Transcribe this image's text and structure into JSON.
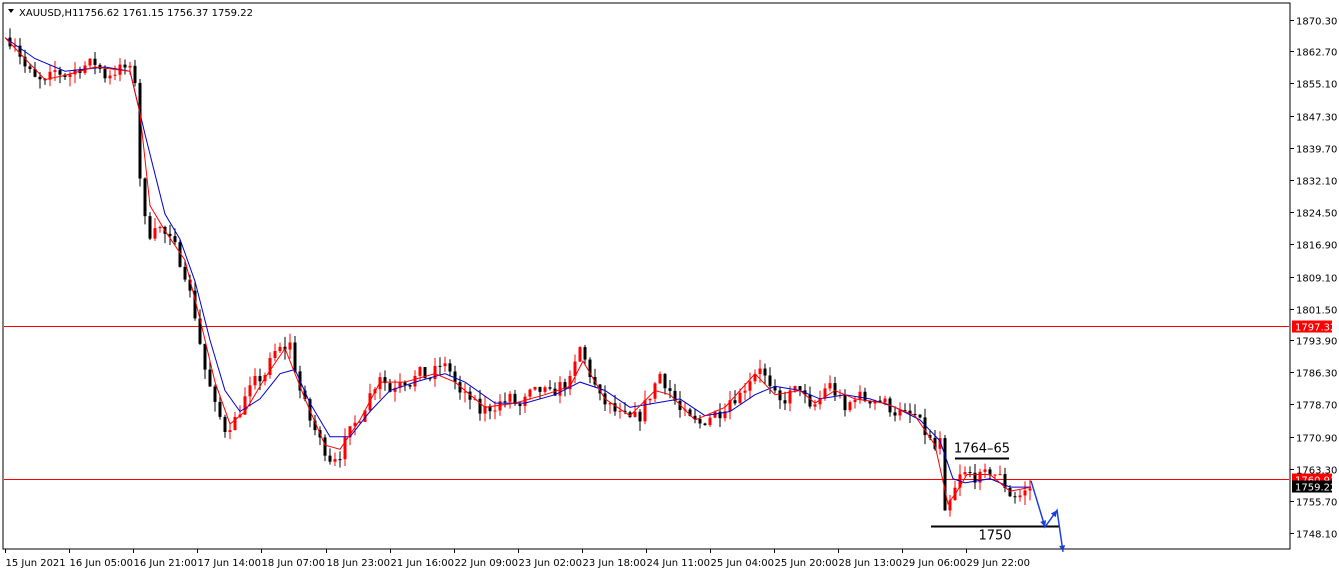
{
  "header": {
    "symbol": "XAUUSD,H1",
    "ohlc": "1756.62 1761.15 1756.37 1759.22"
  },
  "colors": {
    "bull": "#ff0000",
    "bear": "#000000",
    "ma_fast": "#ff0000",
    "ma_slow": "#0000cc",
    "hline": "#ff0000",
    "arrow": "#1a3fe0",
    "price_box_bg": "#ff0000",
    "current_box_bg": "#000000",
    "frame": "#000000"
  },
  "chart_data": {
    "type": "candlestick",
    "title": "",
    "xlabel": "",
    "ylabel": "",
    "ylim": [
      1744.5,
      1874.0
    ],
    "y_ticks": [
      "1870.30",
      "1862.70",
      "1855.10",
      "1847.30",
      "1839.70",
      "1832.10",
      "1824.50",
      "1816.90",
      "1809.10",
      "1801.50",
      "1793.90",
      "1786.30",
      "1778.70",
      "1770.90",
      "1763.30",
      "1755.70",
      "1748.10"
    ],
    "x_ticks": [
      "15 Jun 2021",
      "16 Jun 05:00",
      "16 Jun 21:00",
      "17 Jun 14:00",
      "18 Jun 07:00",
      "18 Jun 23:00",
      "21 Jun 16:00",
      "22 Jun 09:00",
      "23 Jun 02:00",
      "23 Jun 18:00",
      "24 Jun 11:00",
      "25 Jun 04:00",
      "25 Jun 20:00",
      "28 Jun 13:00",
      "29 Jun 06:00",
      "29 Jun 22:00"
    ],
    "price_path": [
      [
        0,
        1866
      ],
      [
        10,
        1865
      ],
      [
        20,
        1859
      ],
      [
        30,
        1856
      ],
      [
        40,
        1855
      ],
      [
        50,
        1858
      ],
      [
        62,
        1857
      ],
      [
        75,
        1859
      ],
      [
        90,
        1860
      ],
      [
        100,
        1857
      ],
      [
        110,
        1858
      ],
      [
        122,
        1859
      ],
      [
        130,
        1856
      ],
      [
        135,
        1833
      ],
      [
        142,
        1818
      ],
      [
        150,
        1822
      ],
      [
        160,
        1819
      ],
      [
        170,
        1816
      ],
      [
        180,
        1810
      ],
      [
        190,
        1800
      ],
      [
        200,
        1787
      ],
      [
        210,
        1778
      ],
      [
        220,
        1773
      ],
      [
        230,
        1775
      ],
      [
        240,
        1780
      ],
      [
        250,
        1784
      ],
      [
        260,
        1786
      ],
      [
        270,
        1791
      ],
      [
        285,
        1793
      ],
      [
        295,
        1782
      ],
      [
        305,
        1775
      ],
      [
        315,
        1770
      ],
      [
        325,
        1766
      ],
      [
        335,
        1767
      ],
      [
        345,
        1772
      ],
      [
        355,
        1776
      ],
      [
        365,
        1781
      ],
      [
        375,
        1786
      ],
      [
        385,
        1782
      ],
      [
        395,
        1785
      ],
      [
        405,
        1784
      ],
      [
        415,
        1786
      ],
      [
        425,
        1785
      ],
      [
        435,
        1788
      ],
      [
        445,
        1787
      ],
      [
        455,
        1781
      ],
      [
        465,
        1780
      ],
      [
        475,
        1777
      ],
      [
        485,
        1778
      ],
      [
        495,
        1779
      ],
      [
        505,
        1780
      ],
      [
        515,
        1778
      ],
      [
        525,
        1781
      ],
      [
        535,
        1782
      ],
      [
        545,
        1781
      ],
      [
        555,
        1783
      ],
      [
        565,
        1784
      ],
      [
        575,
        1792
      ],
      [
        585,
        1786
      ],
      [
        595,
        1780
      ],
      [
        605,
        1778
      ],
      [
        615,
        1776
      ],
      [
        625,
        1775
      ],
      [
        635,
        1776
      ],
      [
        645,
        1781
      ],
      [
        655,
        1786
      ],
      [
        665,
        1782
      ],
      [
        675,
        1777
      ],
      [
        685,
        1775
      ],
      [
        695,
        1774
      ],
      [
        705,
        1776
      ],
      [
        715,
        1777
      ],
      [
        725,
        1780
      ],
      [
        735,
        1781
      ],
      [
        745,
        1785
      ],
      [
        755,
        1788
      ],
      [
        765,
        1782
      ],
      [
        775,
        1779
      ],
      [
        785,
        1781
      ],
      [
        795,
        1783
      ],
      [
        805,
        1777
      ],
      [
        815,
        1780
      ],
      [
        822,
        1784
      ],
      [
        832,
        1781
      ],
      [
        840,
        1777
      ],
      [
        850,
        1781
      ],
      [
        860,
        1780
      ],
      [
        870,
        1780
      ],
      [
        880,
        1779
      ],
      [
        890,
        1777
      ],
      [
        900,
        1776
      ],
      [
        910,
        1776
      ],
      [
        920,
        1772
      ],
      [
        930,
        1768
      ],
      [
        936,
        1770
      ],
      [
        940,
        1752
      ],
      [
        948,
        1757
      ],
      [
        956,
        1762
      ],
      [
        966,
        1762
      ],
      [
        976,
        1761
      ],
      [
        986,
        1763
      ],
      [
        996,
        1761
      ],
      [
        1006,
        1757
      ],
      [
        1016,
        1757
      ],
      [
        1026,
        1759
      ]
    ],
    "ma_fast": [
      [
        0,
        1866
      ],
      [
        20,
        1861
      ],
      [
        40,
        1856
      ],
      [
        60,
        1857
      ],
      [
        90,
        1859
      ],
      [
        125,
        1858
      ],
      [
        135,
        1848
      ],
      [
        145,
        1826
      ],
      [
        160,
        1820
      ],
      [
        180,
        1813
      ],
      [
        195,
        1799
      ],
      [
        210,
        1784
      ],
      [
        225,
        1774
      ],
      [
        240,
        1777
      ],
      [
        260,
        1785
      ],
      [
        280,
        1792
      ],
      [
        300,
        1780
      ],
      [
        320,
        1769
      ],
      [
        335,
        1768
      ],
      [
        355,
        1775
      ],
      [
        375,
        1784
      ],
      [
        400,
        1784
      ],
      [
        430,
        1786
      ],
      [
        450,
        1784
      ],
      [
        480,
        1778
      ],
      [
        510,
        1779
      ],
      [
        540,
        1781
      ],
      [
        565,
        1783
      ],
      [
        578,
        1789
      ],
      [
        600,
        1780
      ],
      [
        625,
        1776
      ],
      [
        650,
        1782
      ],
      [
        665,
        1781
      ],
      [
        690,
        1775
      ],
      [
        720,
        1778
      ],
      [
        750,
        1786
      ],
      [
        770,
        1781
      ],
      [
        795,
        1782
      ],
      [
        810,
        1779
      ],
      [
        830,
        1782
      ],
      [
        850,
        1780
      ],
      [
        880,
        1779
      ],
      [
        910,
        1776
      ],
      [
        930,
        1769
      ],
      [
        943,
        1755
      ],
      [
        952,
        1758
      ],
      [
        962,
        1762
      ],
      [
        985,
        1762
      ],
      [
        1005,
        1758
      ],
      [
        1026,
        1759
      ]
    ],
    "ma_slow": [
      [
        0,
        1866
      ],
      [
        30,
        1861
      ],
      [
        60,
        1858
      ],
      [
        100,
        1859
      ],
      [
        125,
        1858
      ],
      [
        140,
        1843
      ],
      [
        160,
        1824
      ],
      [
        175,
        1818
      ],
      [
        190,
        1808
      ],
      [
        205,
        1794
      ],
      [
        220,
        1782
      ],
      [
        235,
        1777
      ],
      [
        255,
        1780
      ],
      [
        275,
        1786
      ],
      [
        290,
        1787
      ],
      [
        305,
        1779
      ],
      [
        325,
        1771
      ],
      [
        345,
        1771
      ],
      [
        365,
        1777
      ],
      [
        385,
        1782
      ],
      [
        410,
        1784
      ],
      [
        440,
        1786
      ],
      [
        460,
        1784
      ],
      [
        490,
        1779
      ],
      [
        520,
        1779
      ],
      [
        550,
        1781
      ],
      [
        575,
        1784
      ],
      [
        600,
        1782
      ],
      [
        625,
        1778
      ],
      [
        650,
        1779
      ],
      [
        675,
        1780
      ],
      [
        700,
        1776
      ],
      [
        725,
        1777
      ],
      [
        750,
        1781
      ],
      [
        770,
        1783
      ],
      [
        795,
        1782
      ],
      [
        815,
        1780
      ],
      [
        840,
        1781
      ],
      [
        865,
        1780
      ],
      [
        890,
        1778
      ],
      [
        915,
        1775
      ],
      [
        935,
        1770
      ],
      [
        948,
        1761
      ],
      [
        960,
        1760
      ],
      [
        985,
        1761
      ],
      [
        1005,
        1759
      ],
      [
        1026,
        1759
      ]
    ],
    "hlines": [
      {
        "value": 1797.32,
        "label": "1797.32"
      },
      {
        "value": 1760.93,
        "label": "1760.93"
      }
    ],
    "current_price": {
      "value": 1759.22,
      "label": "1759.22"
    },
    "annotations": [
      {
        "text": "1764–65",
        "line_value": 1765.9,
        "x1": 950,
        "x2": 1004
      },
      {
        "text": "1750",
        "line_value": 1749.8,
        "x1": 926,
        "x2": 1054
      }
    ],
    "projection": [
      [
        1026,
        1760.5
      ],
      [
        1040,
        1749.5
      ],
      [
        1052,
        1753.5
      ],
      [
        1058,
        1743.6
      ]
    ]
  }
}
